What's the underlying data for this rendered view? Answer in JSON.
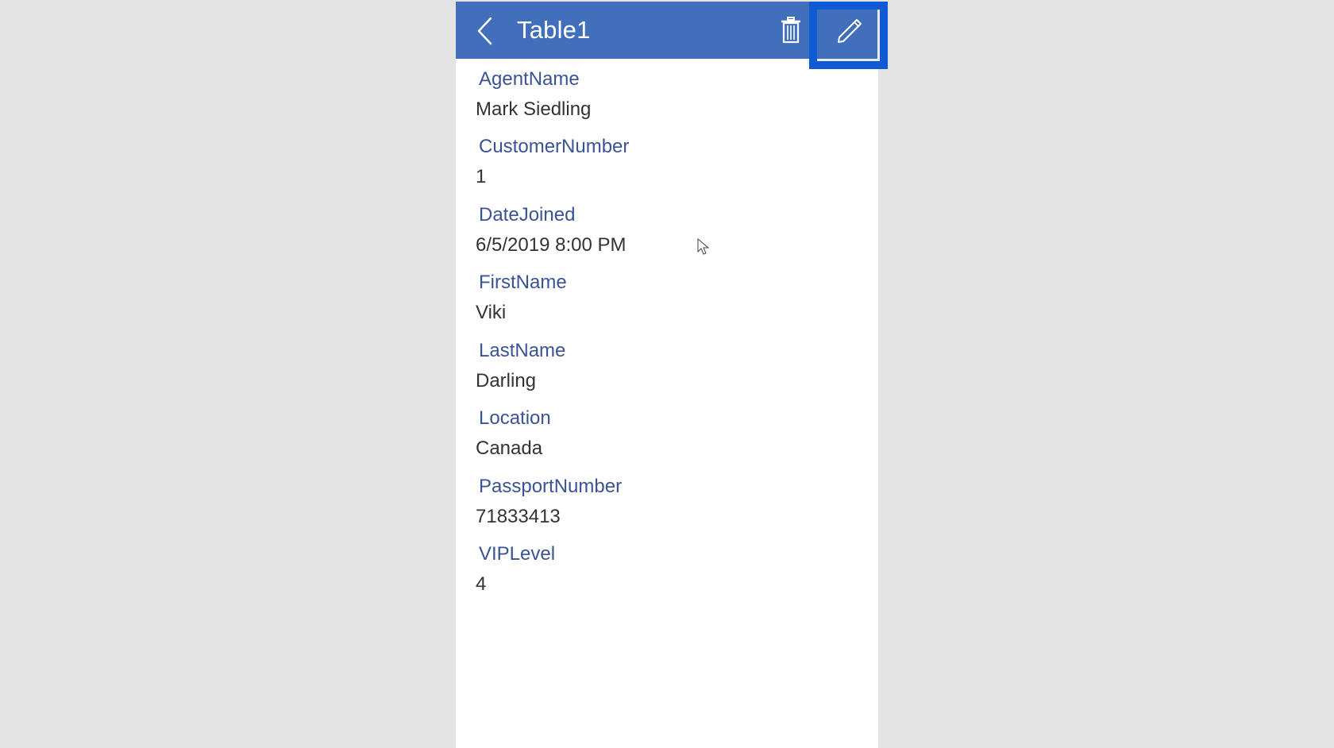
{
  "header": {
    "title": "Table1",
    "back_icon": "chevron-left-icon",
    "delete_icon": "trash-icon",
    "edit_icon": "pencil-icon",
    "background_color": "#416fbb",
    "highlight_color": "#0f5bd6"
  },
  "fields": [
    {
      "label": "AgentName",
      "value": "Mark Siedling"
    },
    {
      "label": "CustomerNumber",
      "value": "1"
    },
    {
      "label": "DateJoined",
      "value": "6/5/2019 8:00 PM"
    },
    {
      "label": "FirstName",
      "value": "Viki"
    },
    {
      "label": "LastName",
      "value": "Darling"
    },
    {
      "label": "Location",
      "value": "Canada"
    },
    {
      "label": "PassportNumber",
      "value": "71833413"
    },
    {
      "label": "VIPLevel",
      "value": "4"
    }
  ],
  "colors": {
    "label": "#3a5397",
    "value": "#333333",
    "page_background": "#e3e3e3"
  }
}
